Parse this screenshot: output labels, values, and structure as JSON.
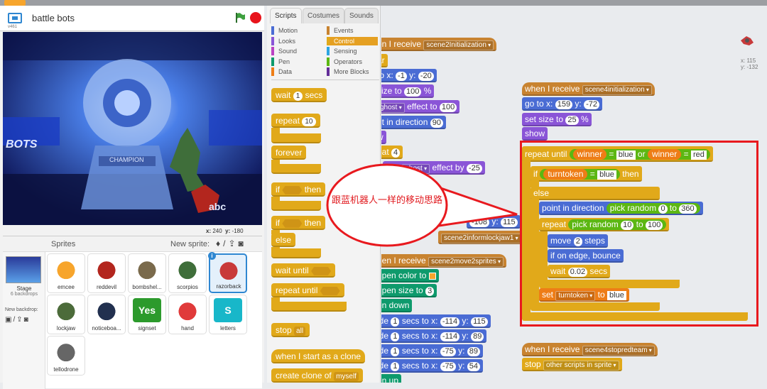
{
  "stage": {
    "title": "battle  bots",
    "version": "v461",
    "banner_text": "BOTS",
    "trophy_text": "CHAMPION",
    "channel_bug": "abc",
    "coords": {
      "x_label": "x:",
      "x": "240",
      "y_label": "y:",
      "y": "-180"
    }
  },
  "sprites": {
    "label": "Sprites",
    "new_sprite_label": "New sprite:",
    "stage_name": "Stage",
    "backdrop_count": "6 backdrops",
    "new_backdrop_label": "New backdrop:",
    "items": [
      {
        "name": "emcee",
        "color": "#f7a52c"
      },
      {
        "name": "reddevil",
        "color": "#b3261e"
      },
      {
        "name": "bombshel...",
        "color": "#7a6a4c"
      },
      {
        "name": "scorpios",
        "color": "#3f6e3a"
      },
      {
        "name": "razorback",
        "color": "#c83a3a",
        "selected": true,
        "info": "i"
      },
      {
        "name": "lockjaw",
        "color": "#4c6b3a"
      },
      {
        "name": "noticeboa...",
        "color": "#22304f"
      },
      {
        "name": "signset",
        "color": "#2c9a2c",
        "text": "Yes"
      },
      {
        "name": "hand",
        "color": "#e03a3a"
      },
      {
        "name": "letters",
        "color": "#18b7c9",
        "text": "S"
      },
      {
        "name": "tellodrone",
        "color": "#666666"
      }
    ]
  },
  "palette": {
    "tabs": [
      "Scripts",
      "Costumes",
      "Sounds"
    ],
    "categories": [
      {
        "label": "Motion",
        "color": "#4a6cd4"
      },
      {
        "label": "Events",
        "color": "#c88330"
      },
      {
        "label": "Looks",
        "color": "#8a55d7"
      },
      {
        "label": "Control",
        "color": "#e1a91a",
        "active": true
      },
      {
        "label": "Sound",
        "color": "#bb42c3"
      },
      {
        "label": "Sensing",
        "color": "#2ca5e2"
      },
      {
        "label": "Pen",
        "color": "#0e9a6c"
      },
      {
        "label": "Operators",
        "color": "#5cb712"
      },
      {
        "label": "Data",
        "color": "#ee7d16"
      },
      {
        "label": "More Blocks",
        "color": "#632d99"
      }
    ],
    "blocks": {
      "wait": "wait",
      "wait_val": "1",
      "wait_secs": "secs",
      "repeat": "repeat",
      "repeat_val": "10",
      "forever": "forever",
      "if": "if",
      "then": "then",
      "if2": "if",
      "then2": "then",
      "else": "else",
      "wait_until": "wait until",
      "repeat_until": "repeat until",
      "stop": "stop",
      "stop_val": "all",
      "when_clone": "when I start as a clone",
      "create_clone": "create clone of",
      "create_clone_val": "myself"
    }
  },
  "scripts": {
    "left_stack": [
      {
        "text": "en I receive",
        "dd": "scene2Initialization"
      },
      {
        "text": "ar"
      },
      {
        "text": "to x:",
        "a": "-1",
        "mid": "y:",
        "b": "-20"
      },
      {
        "text": "size to",
        "a": "100",
        "tail": "%"
      },
      {
        "dd": "ghost",
        "text": "effect to",
        "a": "100"
      },
      {
        "text": "nt in direction",
        "a": "90"
      },
      {
        "text": "w"
      },
      {
        "text": "eat",
        "a": "4"
      },
      {
        "text": "nge",
        "dd": "ghost",
        "tail": "effect by",
        "a": "-25"
      },
      {
        "a": "-108",
        "mid": "y:",
        "b": "115"
      },
      {
        "dd": "scene2informlockjaw1"
      },
      {
        "text": "hen I receive",
        "dd": "scene2move2sprites"
      },
      {
        "text": "t pen color to"
      },
      {
        "text": "t pen size to",
        "a": "3"
      },
      {
        "text": "en down"
      },
      {
        "text": "ide",
        "a": "1",
        "mid": "secs to x:",
        "b": "-114",
        "mid2": "y:",
        "c": "115"
      },
      {
        "text": "ide",
        "a": "1",
        "mid": "secs to x:",
        "b": "-114",
        "mid2": "y:",
        "c": "89"
      },
      {
        "text": "ide",
        "a": "1",
        "mid": "secs to x:",
        "b": "-75",
        "mid2": "y:",
        "c": "89"
      },
      {
        "text": "ide",
        "a": "1",
        "mid": "secs to x:",
        "b": "-75",
        "mid2": "y:",
        "c": "54"
      },
      {
        "text": "en up"
      }
    ],
    "main": {
      "hat": "when I receive",
      "hat_dd": "scene4initialization",
      "goto": "go to x:",
      "goto_x": "159",
      "goto_y_label": "y:",
      "goto_y": "-72",
      "size": "set size to",
      "size_val": "25",
      "size_tail": "%",
      "show": "show",
      "repeat_until": "repeat until",
      "winner1": "winner",
      "eq1": "=",
      "blue": "blue",
      "or": "or",
      "winner2": "winner",
      "eq2": "=",
      "red": "red",
      "if": "if",
      "turntoken": "turntoken",
      "eq3": "=",
      "blue2": "blue",
      "then": "then",
      "else": "else",
      "point": "point in direction",
      "pick1": "pick random",
      "pick1_a": "0",
      "pick1_to": "to",
      "pick1_b": "360",
      "repeat": "repeat",
      "pick2": "pick random",
      "pick2_a": "10",
      "pick2_to": "to",
      "pick2_b": "100",
      "move": "move",
      "move_val": "2",
      "move_tail": "steps",
      "bounce": "if on edge, bounce",
      "wait": "wait",
      "wait_val": "0.02",
      "wait_tail": "secs",
      "set": "set",
      "set_dd": "turntoken",
      "set_to": "to",
      "set_val": "blue"
    },
    "stop_script": {
      "hat": "when I receive",
      "hat_dd": "scene4stopredteam",
      "stop": "stop",
      "stop_dd": "other scripts in sprite"
    },
    "sprite_xy": {
      "x": "x: 115",
      "y": "y: -132"
    }
  },
  "annotation": {
    "text": "跟蓝机器人一样的移动思路",
    "color": "#e8191e"
  }
}
